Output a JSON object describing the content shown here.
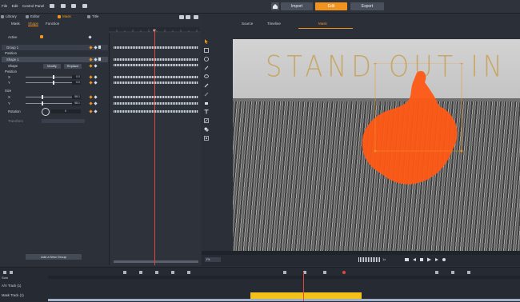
{
  "menu": [
    "File",
    "Edit",
    "Control Panel"
  ],
  "nav": {
    "import": "Import",
    "edit": "Edit",
    "export": "Export"
  },
  "panel_tabs": [
    "Library",
    "Editor",
    "Mask",
    "Title"
  ],
  "left": {
    "subtabs": [
      "Mask",
      "Shape",
      "Function"
    ],
    "active_label": "Active",
    "group": "Group 1",
    "position": "Position",
    "shape": "Shape 1",
    "shape_label": "Shape",
    "modify_btn": "Modify",
    "replace_btn": "Replace",
    "position2": "Position",
    "x": "X",
    "y": "Y",
    "size": "Size",
    "rotation": "Rotation",
    "rotation_value": "0",
    "transform": "Transform",
    "add_group": "Add a New Group",
    "pos_x_val": "0.0",
    "pos_y_val": "0.0",
    "size_x_val": "58.1",
    "size_y_val": "58.1"
  },
  "right": {
    "tabs": [
      "Source",
      "Timeline",
      "Mask"
    ],
    "headline": "STAND OUT IN YOUR FI",
    "speed": "1x"
  },
  "bottom": {
    "fit": "Fit",
    "solo": "Solo",
    "track1": "A/V Track (1)",
    "track2": "Mask Track (1)"
  },
  "colors": {
    "accent": "#f0941f",
    "mask": "#ff5a14",
    "clip": "#f2c21b"
  }
}
